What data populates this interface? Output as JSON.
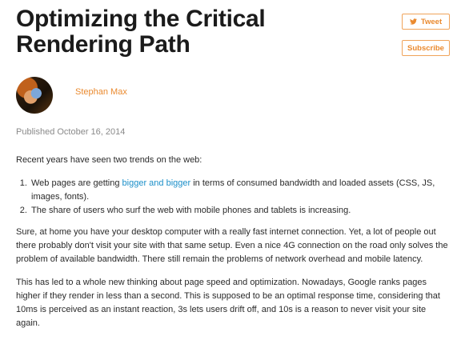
{
  "article": {
    "title_line1": "Optimizing the Critical",
    "title_line2": "Rendering Path",
    "author": "Stephan Max",
    "published": "Published October 16, 2014"
  },
  "actions": {
    "tweet_label": "Tweet",
    "subscribe_label": "Subscribe"
  },
  "body": {
    "intro": "Recent years have seen two trends on the web:",
    "list": [
      {
        "before": "Web pages are getting ",
        "link": "bigger and bigger",
        "after": " in terms of consumed bandwidth and loaded assets (CSS, JS, images, fonts)."
      },
      {
        "text": "The share of users who surf the web with mobile phones and tablets is increasing."
      }
    ],
    "para2": "Sure, at home you have your desktop computer with a really fast internet connection. Yet, a lot of people out there probably don't visit your site with that same setup. Even a nice 4G connection on the road only solves the problem of available bandwidth. There still remain the problems of network overhead and mobile latency.",
    "para3": "This has led to a whole new thinking about page speed and optimization. Nowadays, Google ranks pages higher if they render in less than a second. This is supposed to be an optimal response time, considering that 10ms is perceived as an instant reaction, 3s lets users drift off, and 10s is a reason to never visit your site again."
  },
  "colors": {
    "accent": "#ea8a2f",
    "link": "#1b8fc9",
    "muted": "#8a8a8a",
    "text": "#2a2a2a"
  },
  "icons": {
    "tweet": "twitter-bird-icon"
  }
}
